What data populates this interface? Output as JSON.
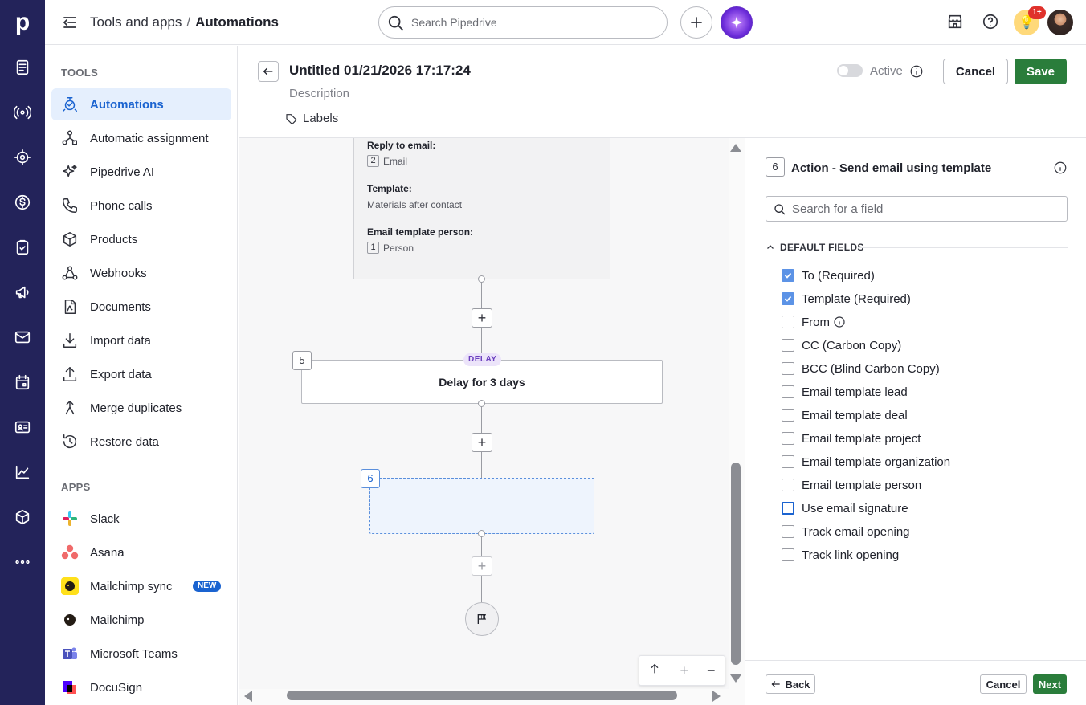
{
  "rail": {
    "logo": "p",
    "icons": [
      "leads-icon",
      "campaigns-icon",
      "deals-icon",
      "dollar-icon",
      "tasks-icon",
      "megaphone-icon",
      "mail-icon",
      "calendar-icon",
      "contacts-icon",
      "insights-icon",
      "products-icon",
      "more-icon"
    ]
  },
  "topbar": {
    "crumb_parent": "Tools and apps",
    "crumb_sep": "/",
    "crumb_current": "Automations",
    "search_placeholder": "Search Pipedrive",
    "notification_count": "1+"
  },
  "sidebar": {
    "tools_heading": "TOOLS",
    "tools": [
      {
        "label": "Automations",
        "icon": "automations-icon",
        "active": true
      },
      {
        "label": "Automatic assignment",
        "icon": "assignment-icon"
      },
      {
        "label": "Pipedrive AI",
        "icon": "sparkle-icon"
      },
      {
        "label": "Phone calls",
        "icon": "phone-icon"
      },
      {
        "label": "Products",
        "icon": "box-icon"
      },
      {
        "label": "Webhooks",
        "icon": "webhook-icon"
      },
      {
        "label": "Documents",
        "icon": "document-icon"
      },
      {
        "label": "Import data",
        "icon": "import-icon"
      },
      {
        "label": "Export data",
        "icon": "export-icon"
      },
      {
        "label": "Merge duplicates",
        "icon": "merge-icon"
      },
      {
        "label": "Restore data",
        "icon": "restore-icon"
      }
    ],
    "apps_heading": "APPS",
    "apps": [
      {
        "label": "Slack",
        "icon": "slack-icon"
      },
      {
        "label": "Asana",
        "icon": "asana-icon"
      },
      {
        "label": "Mailchimp sync",
        "icon": "mailchimp-icon",
        "badge": "NEW"
      },
      {
        "label": "Mailchimp",
        "icon": "mailchimp-icon"
      },
      {
        "label": "Microsoft Teams",
        "icon": "teams-icon"
      },
      {
        "label": "DocuSign",
        "icon": "docusign-icon"
      }
    ]
  },
  "header": {
    "title": "Untitled 01/21/2026 17:17:24",
    "description": "Description",
    "labels": "Labels",
    "active_label": "Active",
    "cancel": "Cancel",
    "save": "Save"
  },
  "canvas": {
    "prev_card": {
      "reply_label": "Reply to email:",
      "reply_num": "2",
      "reply_val": "Email",
      "template_label": "Template:",
      "template_val": "Materials after contact",
      "person_label": "Email template person:",
      "person_num": "1",
      "person_val": "Person"
    },
    "delay_step": "5",
    "delay_tag": "DELAY",
    "delay_text": "Delay for 3 days",
    "action_step": "6"
  },
  "panel": {
    "step": "6",
    "title": "Action - Send email using template",
    "search_placeholder": "Search for a field",
    "section": "DEFAULT FIELDS",
    "fields": [
      {
        "label": "To (Required)",
        "checked": true
      },
      {
        "label": "Template (Required)",
        "checked": true
      },
      {
        "label": "From",
        "checked": false,
        "info": true
      },
      {
        "label": "CC (Carbon Copy)",
        "checked": false
      },
      {
        "label": "BCC (Blind Carbon Copy)",
        "checked": false
      },
      {
        "label": "Email template lead",
        "checked": false
      },
      {
        "label": "Email template deal",
        "checked": false
      },
      {
        "label": "Email template project",
        "checked": false
      },
      {
        "label": "Email template organization",
        "checked": false
      },
      {
        "label": "Email template person",
        "checked": false
      },
      {
        "label": "Use email signature",
        "checked": false,
        "focused": true
      },
      {
        "label": "Track email opening",
        "checked": false
      },
      {
        "label": "Track link opening",
        "checked": false
      }
    ],
    "back": "Back",
    "cancel": "Cancel",
    "next": "Next"
  },
  "colors": {
    "rail_bg": "#23235a",
    "active_bg": "#e5effd",
    "accent_blue": "#1a63d0",
    "save_green": "#2a7d3b"
  }
}
